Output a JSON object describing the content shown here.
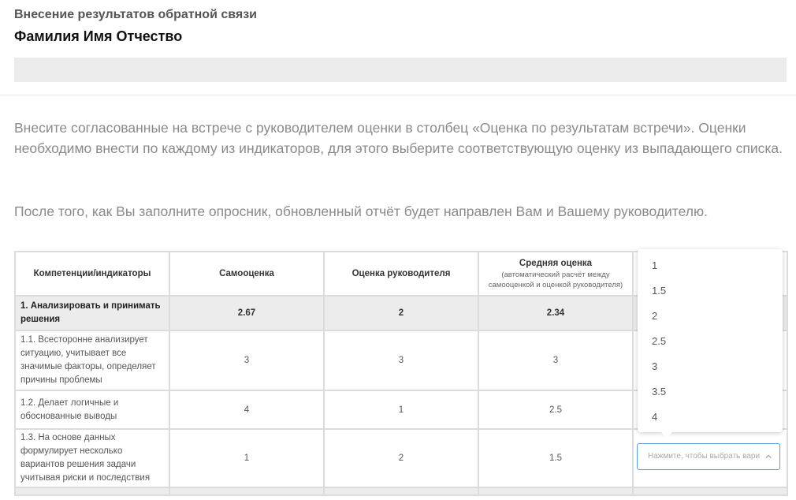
{
  "header": {
    "subtitle": "Внесение результатов обратной связи",
    "name": "Фамилия Имя Отчество"
  },
  "instructions": {
    "p1": "Внесите согласованные на встрече с руководителем оценки в столбец «Оценка по результатам встречи». Оценки необходимо внести по каждому из индикаторов, для этого выберите соответствующую оценку из выпадающего списка.",
    "p2": "После того, как Вы заполните опросник, обновленный отчёт будет направлен Вам и Вашему руководителю."
  },
  "table": {
    "headers": {
      "competency": "Компетенции/индикаторы",
      "self": "Самооценка",
      "manager": "Оценка руководителя",
      "avg": "Средняя оценка",
      "avg_note": "(автоматический расчёт между самооценкой и оценкой руководителя)"
    },
    "rows": [
      {
        "label": "1. Анализировать и принимать решения",
        "self": "2.67",
        "manager": "2",
        "avg": "2.34"
      },
      {
        "label": "1.1. Всесторонне анализирует ситуацию, учитывает все значимые факторы, определяет причины проблемы",
        "self": "3",
        "manager": "3",
        "avg": "3"
      },
      {
        "label": "1.2. Делает логичные и обоснованные выводы",
        "self": "4",
        "manager": "1",
        "avg": "2.5"
      },
      {
        "label": "1.3. На основе данных формулирует несколько вариантов решения задачи учитывая риски и последствия",
        "self": "1",
        "manager": "2",
        "avg": "1.5"
      }
    ]
  },
  "select": {
    "placeholder": "Нажмите, чтобы выбрать вари",
    "options": [
      "1",
      "1.5",
      "2",
      "2.5",
      "3",
      "3.5",
      "4"
    ]
  },
  "icons": {
    "select_chevron": "chevron-up-icon"
  },
  "colors": {
    "focus_border": "#5aa0e0",
    "grey_fill": "#ececec"
  }
}
